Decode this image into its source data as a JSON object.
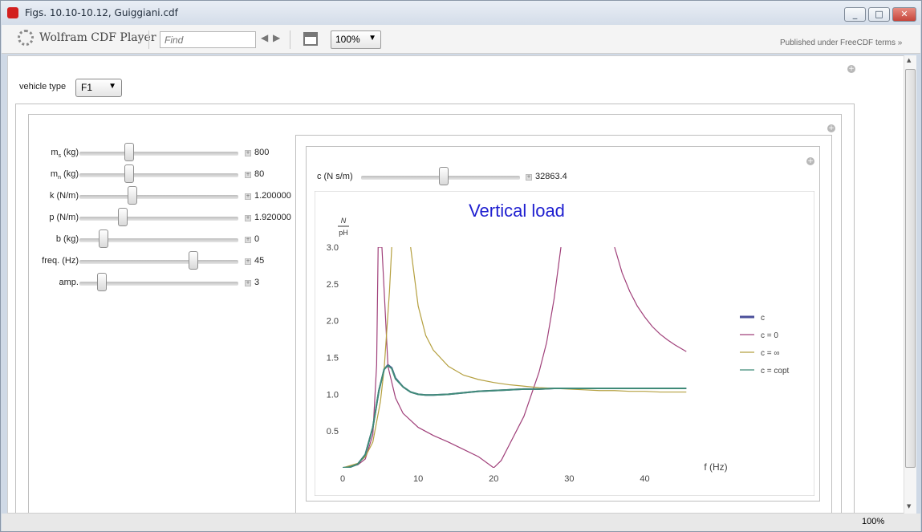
{
  "window": {
    "title": "Figs. 10.10-10.12, Guiggiani.cdf"
  },
  "toolbar": {
    "brand": "Wolfram CDF Player",
    "find_placeholder": "Find",
    "zoom_value": "100%",
    "published": "Published under FreeCDF terms »"
  },
  "controls": {
    "vehicle_type_label": "vehicle type",
    "vehicle_type_value": "F1",
    "sliders": [
      {
        "label": "m",
        "sub": "s",
        "unit": " (kg)",
        "value": "800",
        "fraction": 0.3
      },
      {
        "label": "m",
        "sub": "n",
        "unit": " (kg)",
        "value": "80",
        "fraction": 0.3
      },
      {
        "label": "k (N/m)",
        "sub": "",
        "unit": "",
        "value": "1.200000",
        "fraction": 0.32
      },
      {
        "label": "p (N/m)",
        "sub": "",
        "unit": "",
        "value": "1.920000",
        "fraction": 0.26
      },
      {
        "label": "b (kg)",
        "sub": "",
        "unit": "",
        "value": "0",
        "fraction": 0.13
      },
      {
        "label": "freq. (Hz)",
        "sub": "",
        "unit": "",
        "value": "45",
        "fraction": 0.73
      },
      {
        "label": "amp.",
        "sub": "",
        "unit": "",
        "value": "3",
        "fraction": 0.12
      }
    ],
    "damping": {
      "label": "c (N s/m)",
      "value": "32863.4",
      "fraction": 0.52
    }
  },
  "chart_data": {
    "type": "line",
    "title": "Vertical load",
    "xlabel": "f (Hz)",
    "ylabel_num": "N",
    "ylabel_den": "pH",
    "xlim": [
      0,
      46
    ],
    "ylim": [
      0,
      3
    ],
    "xticks": [
      "0",
      "10",
      "20",
      "30",
      "40"
    ],
    "yticks": [
      "0.5",
      "1.0",
      "1.5",
      "2.0",
      "2.5",
      "3.0"
    ],
    "legend_position": "right",
    "series": [
      {
        "name": "c",
        "color": "#4b4f9a",
        "x": [
          0,
          1,
          2,
          3,
          4,
          4.8,
          5.5,
          6,
          6.5,
          7,
          8,
          9,
          10,
          11,
          12,
          14,
          16,
          18,
          20,
          22,
          24,
          26,
          28,
          30,
          32,
          34,
          36,
          38,
          40,
          42,
          44,
          45.5
        ],
        "y": [
          0,
          0.01,
          0.05,
          0.18,
          0.55,
          1.05,
          1.34,
          1.4,
          1.36,
          1.22,
          1.1,
          1.03,
          1.0,
          0.99,
          0.99,
          1.0,
          1.02,
          1.04,
          1.05,
          1.06,
          1.07,
          1.07,
          1.08,
          1.08,
          1.08,
          1.08,
          1.08,
          1.08,
          1.08,
          1.08,
          1.08,
          1.08
        ]
      },
      {
        "name": "c = 0",
        "color": "#a0407a",
        "x": [
          0,
          2,
          3,
          4,
          4.5,
          4.7,
          5.2,
          5.6,
          6,
          7,
          8,
          10,
          12,
          14,
          16,
          18,
          20,
          21,
          22,
          24,
          26,
          27,
          28,
          28.9
        ],
        "y": [
          0,
          0.04,
          0.12,
          0.45,
          1.4,
          3.0,
          3.0,
          2.2,
          1.38,
          0.95,
          0.74,
          0.55,
          0.44,
          0.35,
          0.25,
          0.15,
          0.0,
          0.1,
          0.3,
          0.7,
          1.3,
          1.7,
          2.3,
          3.0
        ]
      },
      {
        "name": "c = ∞",
        "color": "#b5a040",
        "x": [
          0,
          2,
          3,
          4,
          5,
          5.5,
          6.2,
          6.5
        ],
        "y": [
          0,
          0.06,
          0.15,
          0.35,
          0.9,
          1.35,
          2.4,
          3.0
        ]
      },
      {
        "name": "c = ∞ (upper)",
        "color": "#b5a040",
        "x": [
          9,
          10,
          11,
          12,
          14,
          16,
          18,
          20,
          22,
          24,
          26,
          28,
          30,
          32,
          34,
          36,
          38,
          40,
          42,
          44,
          45.5
        ],
        "y": [
          3.0,
          2.2,
          1.8,
          1.6,
          1.38,
          1.26,
          1.2,
          1.16,
          1.13,
          1.11,
          1.09,
          1.08,
          1.07,
          1.06,
          1.05,
          1.05,
          1.04,
          1.04,
          1.03,
          1.03,
          1.03
        ]
      },
      {
        "name": "c = ∞ (upper right)",
        "color": "#a0407a",
        "x": [
          36,
          37,
          38,
          39,
          40,
          41,
          42,
          43,
          44,
          45.5
        ],
        "y": [
          3.0,
          2.65,
          2.4,
          2.2,
          2.05,
          1.92,
          1.82,
          1.74,
          1.67,
          1.58
        ]
      },
      {
        "name": "c = copt",
        "color": "#3f8a78",
        "x": [
          0,
          1,
          2,
          3,
          4,
          4.8,
          5.5,
          6,
          6.5,
          7,
          8,
          9,
          10,
          11,
          12,
          14,
          16,
          18,
          20,
          22,
          24,
          26,
          28,
          30,
          32,
          34,
          36,
          38,
          40,
          42,
          44,
          45.5
        ],
        "y": [
          0,
          0.01,
          0.05,
          0.18,
          0.55,
          1.05,
          1.34,
          1.39,
          1.35,
          1.21,
          1.1,
          1.03,
          1.0,
          0.99,
          0.99,
          1.0,
          1.02,
          1.04,
          1.05,
          1.06,
          1.07,
          1.07,
          1.08,
          1.08,
          1.08,
          1.08,
          1.08,
          1.08,
          1.08,
          1.08,
          1.08,
          1.08
        ]
      }
    ],
    "legend": [
      {
        "label": "c",
        "color": "#4b4f9a"
      },
      {
        "label": "c = 0",
        "color": "#a0407a"
      },
      {
        "label": "c = ∞",
        "color": "#b5a040"
      },
      {
        "label": "c = copt",
        "color": "#3f8a78"
      }
    ]
  },
  "status": {
    "zoom": "100%"
  }
}
